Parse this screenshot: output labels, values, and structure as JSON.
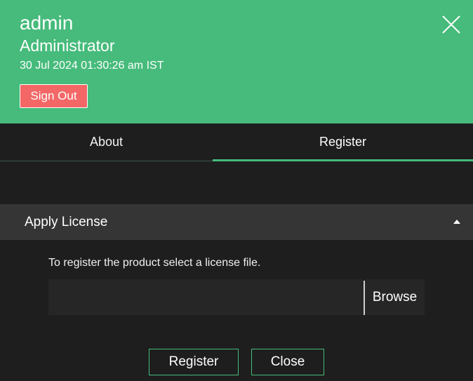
{
  "header": {
    "username": "admin",
    "role": "Administrator",
    "datetime": "30 Jul 2024 01:30:26 am IST",
    "sign_out_label": "Sign Out"
  },
  "tabs": [
    {
      "label": "About",
      "active": false
    },
    {
      "label": "Register",
      "active": true
    }
  ],
  "section": {
    "title": "Apply License",
    "expanded": true,
    "description": "To register the product select a license file.",
    "file_input_value": "",
    "browse_label": "Browse"
  },
  "actions": {
    "register_label": "Register",
    "close_label": "Close"
  },
  "icons": {
    "close": "close-icon",
    "caret": "caret-up-icon"
  },
  "colors": {
    "accent": "#46bb7b",
    "sign_out": "#f36767",
    "background": "#1e1e1e",
    "section_header": "#353535"
  }
}
